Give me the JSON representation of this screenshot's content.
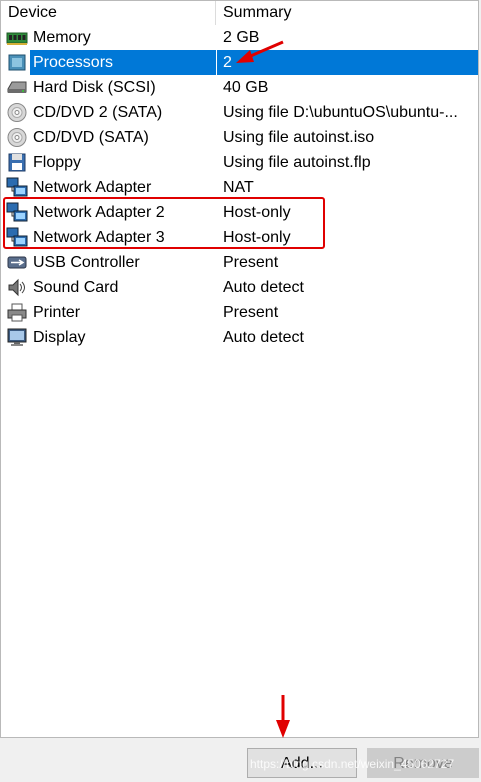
{
  "header": {
    "device": "Device",
    "summary": "Summary"
  },
  "devices": [
    {
      "name": "Memory",
      "summary": "2 GB",
      "icon": "memory-icon"
    },
    {
      "name": "Processors",
      "summary": "2",
      "icon": "processor-icon",
      "selected": true
    },
    {
      "name": "Hard Disk (SCSI)",
      "summary": "40 GB",
      "icon": "hard-disk-icon"
    },
    {
      "name": "CD/DVD 2 (SATA)",
      "summary": "Using file D:\\ubuntuOS\\ubuntu-...",
      "icon": "cd-dvd-icon"
    },
    {
      "name": "CD/DVD (SATA)",
      "summary": "Using file autoinst.iso",
      "icon": "cd-dvd-icon"
    },
    {
      "name": "Floppy",
      "summary": "Using file autoinst.flp",
      "icon": "floppy-icon"
    },
    {
      "name": "Network Adapter",
      "summary": "NAT",
      "icon": "network-adapter-icon"
    },
    {
      "name": "Network Adapter 2",
      "summary": "Host-only",
      "icon": "network-adapter-icon"
    },
    {
      "name": "Network Adapter 3",
      "summary": "Host-only",
      "icon": "network-adapter-icon"
    },
    {
      "name": "USB Controller",
      "summary": "Present",
      "icon": "usb-icon"
    },
    {
      "name": "Sound Card",
      "summary": "Auto detect",
      "icon": "speaker-icon"
    },
    {
      "name": "Printer",
      "summary": "Present",
      "icon": "printer-icon"
    },
    {
      "name": "Display",
      "summary": "Auto detect",
      "icon": "display-icon"
    }
  ],
  "buttons": {
    "add": "Add...",
    "remove": "Remove"
  },
  "watermark": "https://blog.csdn.net/weixin_45062727",
  "colors": {
    "selection": "#0078d7",
    "annotation": "#e00000"
  }
}
